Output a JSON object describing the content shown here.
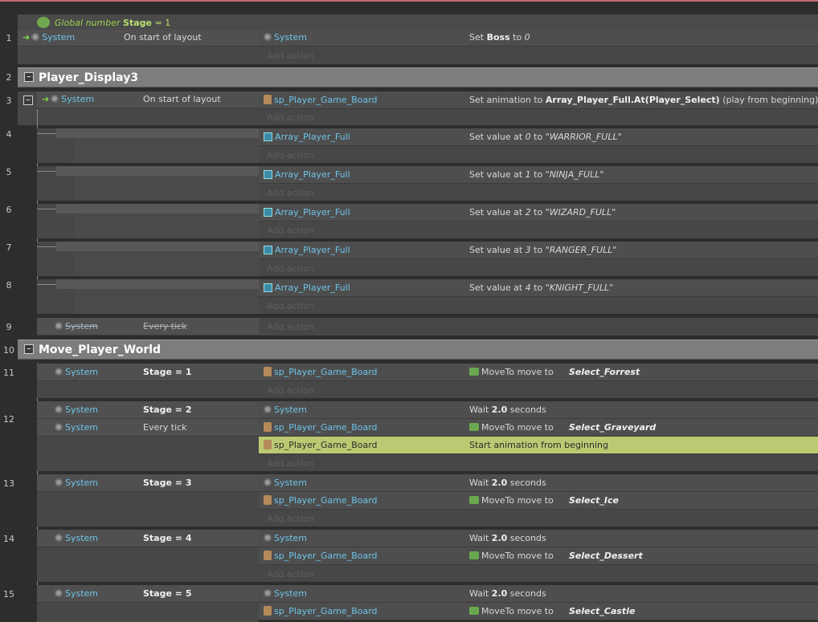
{
  "global": {
    "label": "Global number",
    "name": "Stage",
    "eq": "= 1"
  },
  "lines": [
    "1",
    "2",
    "3",
    "4",
    "5",
    "6",
    "7",
    "8",
    "9",
    "10",
    "11",
    "12",
    "13",
    "14",
    "15"
  ],
  "common": {
    "system": "System",
    "on_start": "On start of layout",
    "every_tick": "Every tick",
    "add_action": "Add action",
    "sp": "sp_Player_Game_Board",
    "array": "Array_Player_Full",
    "wait_pre": "Wait",
    "wait_val": "2.0",
    "wait_post": "seconds",
    "moveto": "MoveTo move to"
  },
  "ev1": {
    "act_pre": "Set",
    "act_b": "Boss",
    "act_mid": "to",
    "act_i": "0"
  },
  "group1": {
    "title": "Player_Display3"
  },
  "ev3": {
    "act_pre": "Set animation to",
    "act_b": "Array_Player_Full.At(Player_Select)",
    "act_post": "(play from beginning)"
  },
  "setvals": [
    {
      "pre": "Set value at",
      "idx": "0",
      "to": "to",
      "val": "\"WARRIOR_FULL\""
    },
    {
      "pre": "Set value at",
      "idx": "1",
      "to": "to",
      "val": "\"NINJA_FULL\""
    },
    {
      "pre": "Set value at",
      "idx": "2",
      "to": "to",
      "val": "\"WIZARD_FULL\""
    },
    {
      "pre": "Set value at",
      "idx": "3",
      "to": "to",
      "val": "\"RANGER_FULL\""
    },
    {
      "pre": "Set value at",
      "idx": "4",
      "to": "to",
      "val": "\"KNIGHT_FULL\""
    }
  ],
  "group2": {
    "title": "Move_Player_World"
  },
  "stages": [
    "Stage = 1",
    "Stage = 2",
    "Stage = 3",
    "Stage = 4",
    "Stage = 5"
  ],
  "targets": [
    "Select_Forrest",
    "Select_Graveyard",
    "Select_Ice",
    "Select_Dessert",
    "Select_Castle"
  ],
  "highlight": {
    "obj": "sp_Player_Game_Board",
    "act": "Start animation from beginning"
  }
}
